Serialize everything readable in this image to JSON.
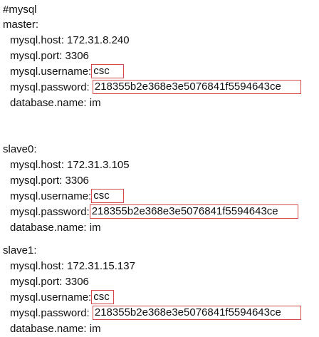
{
  "comment": "#mysql",
  "sections": [
    {
      "header": "master:",
      "host_label": "mysql.host:",
      "host": "172.31.8.240",
      "port_label": "mysql.port:",
      "port": "3306",
      "username_label": "mysql.username:",
      "username": "csc",
      "password_label": "mysql.password:",
      "password": "218355b2e368e3e5076841f5594643ce",
      "database_label": "database.name:",
      "database": "im"
    },
    {
      "header": "slave0:",
      "host_label": "mysql.host:",
      "host": "172.31.3.105",
      "port_label": "mysql.port:",
      "port": "3306",
      "username_label": "mysql.username:",
      "username": "csc",
      "password_label": "mysql.password:",
      "password": "218355b2e368e3e5076841f5594643ce",
      "database_label": "database.name:",
      "database": "im"
    },
    {
      "header": "slave1:",
      "host_label": "mysql.host:",
      "host": "172.31.15.137",
      "port_label": "mysql.port:",
      "port": "3306",
      "username_label": "mysql.username:",
      "username": "csc",
      "password_label": "mysql.password:",
      "password": "218355b2e368e3e5076841f5594643ce",
      "database_label": "database.name:",
      "database": "im"
    }
  ],
  "colors": {
    "highlight_box": "#d44a4a",
    "text": "#111111",
    "background": "#ffffff"
  }
}
